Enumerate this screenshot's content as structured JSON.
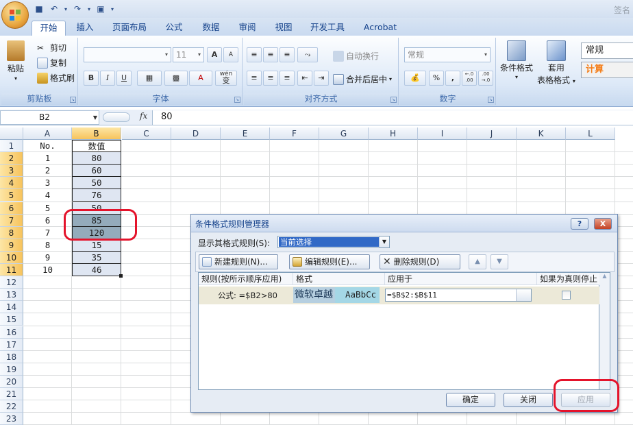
{
  "title_right": "签名",
  "tabs": [
    "开始",
    "插入",
    "页面布局",
    "公式",
    "数据",
    "审阅",
    "视图",
    "开发工具",
    "Acrobat"
  ],
  "ribbon": {
    "clipboard": {
      "paste": "粘贴",
      "cut": "剪切",
      "copy": "复制",
      "format_painter": "格式刷",
      "label": "剪贴板"
    },
    "font": {
      "font_size": "11",
      "bold": "B",
      "italic": "I",
      "underline": "U",
      "phonetic": "wén",
      "phonetic_char": "变",
      "grow_glyph": "A",
      "shrink_glyph": "A",
      "font_color_glyph": "A",
      "label": "字体"
    },
    "alignment": {
      "wrap": "自动换行",
      "merge": "合并后居中",
      "label": "对齐方式"
    },
    "number": {
      "format": "常规",
      "percent": "%",
      "comma": ",",
      "inc_decimal": "←.0 .00",
      "dec_decimal": ".00 →.0",
      "label": "数字"
    },
    "styles": {
      "conditional": "条件格式",
      "table_format_1": "套用",
      "table_format_2": "表格格式",
      "style_normal": "常规",
      "style_calc": "计算"
    }
  },
  "formula_bar": {
    "name_box": "B2",
    "fx": "fx",
    "value": "80"
  },
  "columns": [
    "A",
    "B",
    "C",
    "D",
    "E",
    "F",
    "G",
    "H",
    "I",
    "J",
    "K",
    "L"
  ],
  "rows": [
    "1",
    "2",
    "3",
    "4",
    "5",
    "6",
    "7",
    "8",
    "9",
    "10",
    "11",
    "12",
    "13",
    "14",
    "15",
    "16",
    "17",
    "18",
    "19",
    "20",
    "21",
    "22",
    "23"
  ],
  "sheet": {
    "header_a": "No.",
    "header_b": "数值",
    "no": [
      "1",
      "2",
      "3",
      "4",
      "5",
      "6",
      "7",
      "8",
      "9",
      "10"
    ],
    "values": [
      "80",
      "60",
      "50",
      "76",
      "50",
      "85",
      "120",
      "15",
      "35",
      "46"
    ]
  },
  "dialog": {
    "title": "条件格式规则管理器",
    "help": "?",
    "close": "X",
    "show_label": "显示其格式规则(S):",
    "show_value": "当前选择",
    "new_rule": "新建规则(N)...",
    "edit_rule": "编辑规则(E)...",
    "delete_rule": "删除规则(D)",
    "move_up": "▲",
    "move_down": "▼",
    "col_rule": "规则(按所示顺序应用)",
    "col_format": "格式",
    "col_applies": "应用于",
    "col_stop": "如果为真则停止",
    "rule_text": "公式: =$B2>80",
    "preview_text_1": "微软卓越",
    "preview_text_2": "AaBbCc",
    "applies_value": "=$B$2:$B$11",
    "ok": "确定",
    "close_btn": "关闭",
    "apply": "应用"
  },
  "colors": {
    "highlight": "#94abbb",
    "selection": "#dfe6f2",
    "annotation": "#e4132b"
  }
}
